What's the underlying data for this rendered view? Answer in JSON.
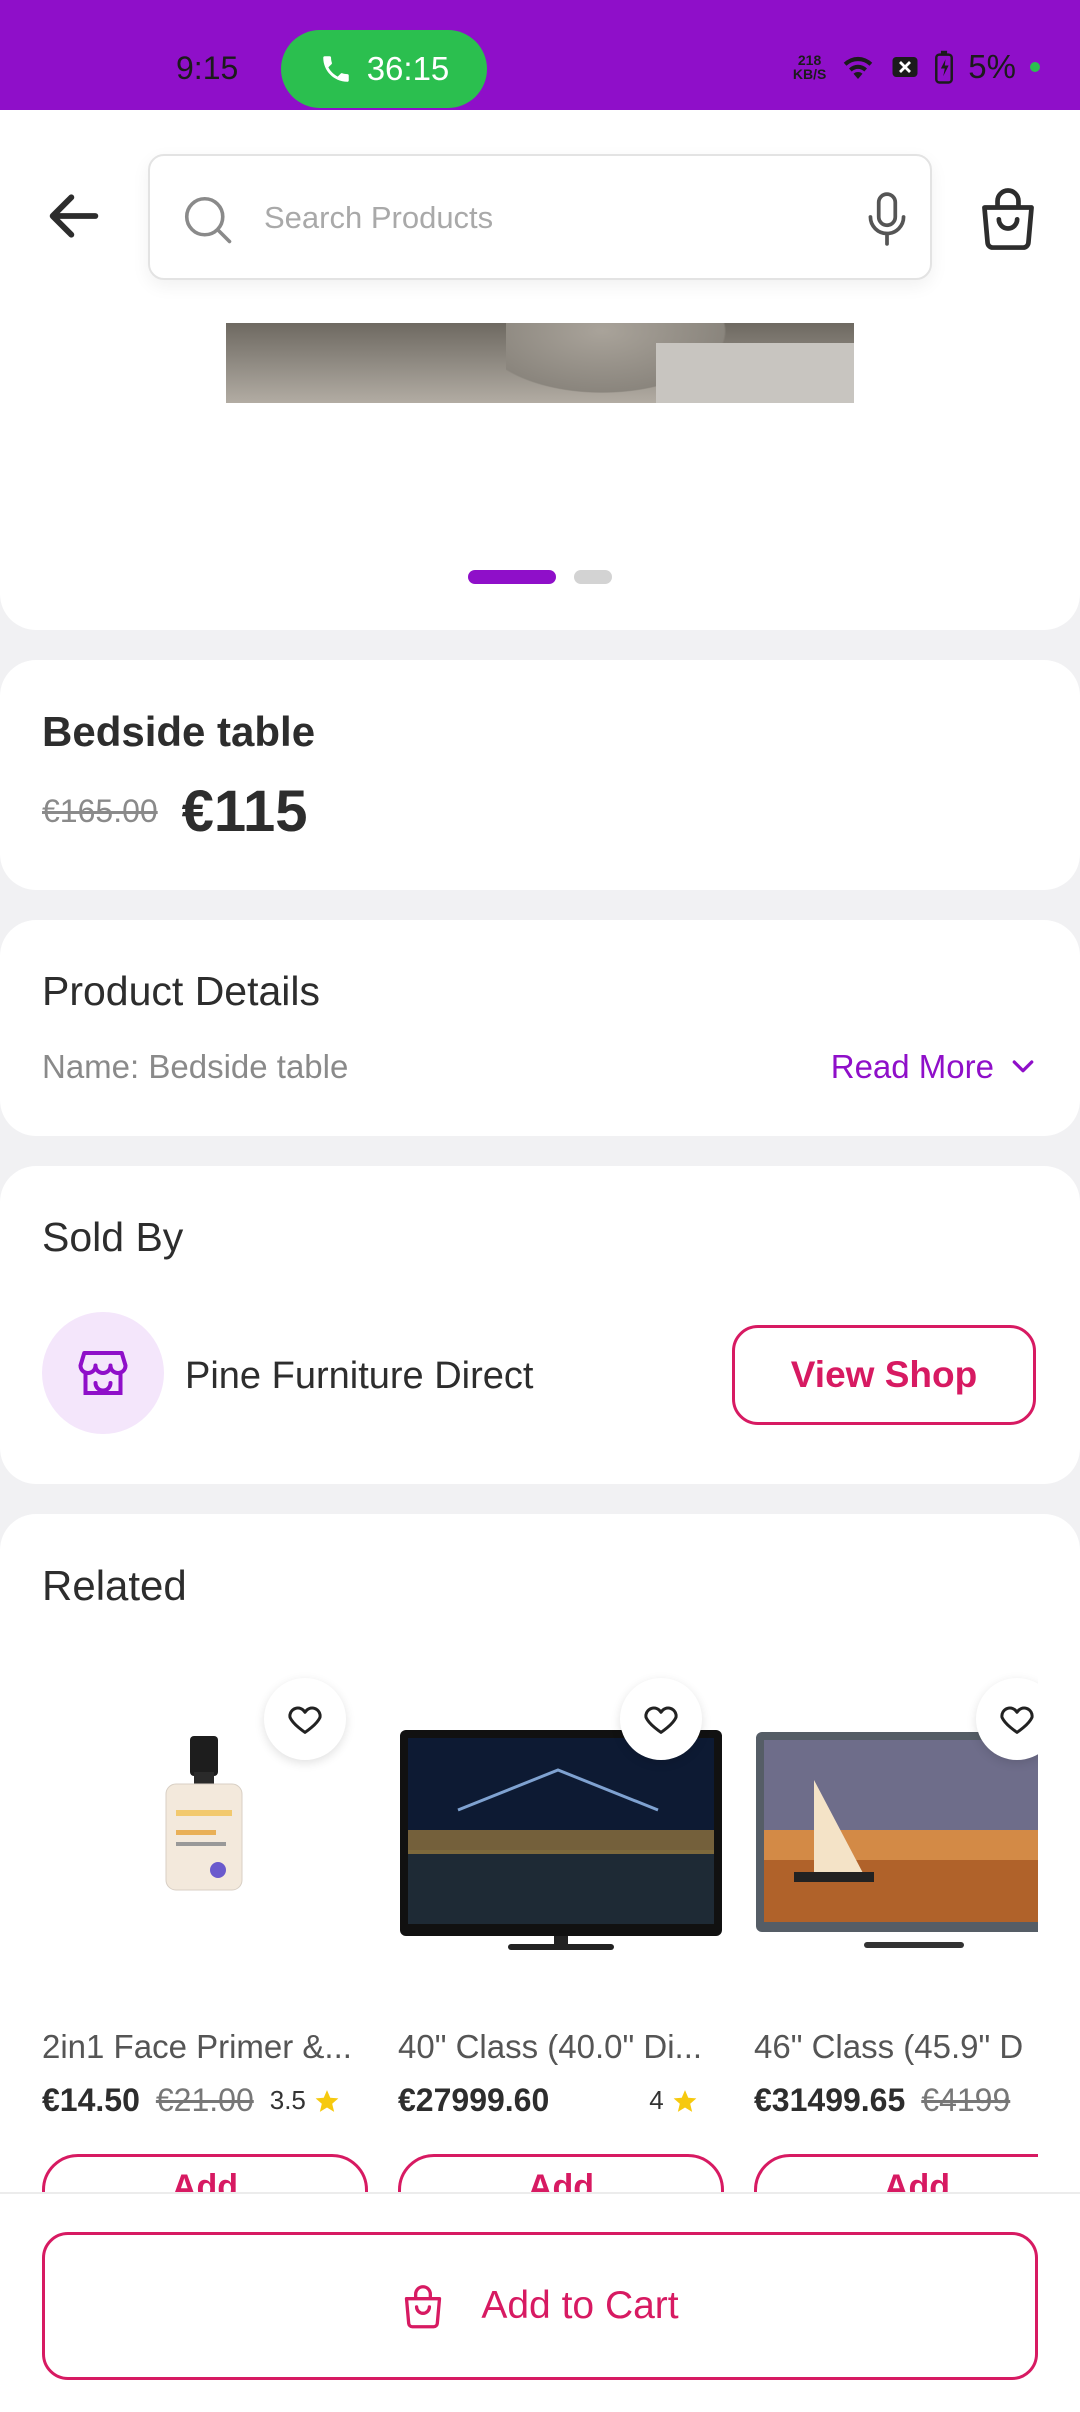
{
  "status_bar": {
    "time": "9:15",
    "call_duration": "36:15",
    "net_speed_top": "218",
    "net_speed_bottom": "KB/S",
    "battery": "5%"
  },
  "header": {
    "search_placeholder": "Search Products"
  },
  "carousel": {
    "pages": 2,
    "active_page": 1
  },
  "product": {
    "title": "Bedside table",
    "old_price": "€165.00",
    "price": "€115"
  },
  "details": {
    "heading": "Product Details",
    "summary": "Name: Bedside table",
    "read_more": "Read More"
  },
  "seller": {
    "heading": "Sold By",
    "name": "Pine Furniture Direct",
    "view_shop": "View Shop"
  },
  "related": {
    "heading": "Related",
    "items": [
      {
        "name": "2in1 Face Primer &...",
        "price": "€14.50",
        "old_price": "€21.00",
        "rating": "3.5",
        "add_label": "Add"
      },
      {
        "name": "40\" Class (40.0\" Di...",
        "price": "€27999.60",
        "old_price": "",
        "rating": "4",
        "add_label": "Add"
      },
      {
        "name": "46\" Class (45.9\" D",
        "price": "€31499.65",
        "old_price": "€4199",
        "rating": "",
        "add_label": "Add"
      }
    ]
  },
  "bottom": {
    "add_to_cart": "Add to Cart"
  },
  "colors": {
    "brand_purple": "#8f0fc9",
    "accent_pink": "#d71a62",
    "call_green": "#2bbf4f",
    "star_yellow": "#f6c90e"
  }
}
